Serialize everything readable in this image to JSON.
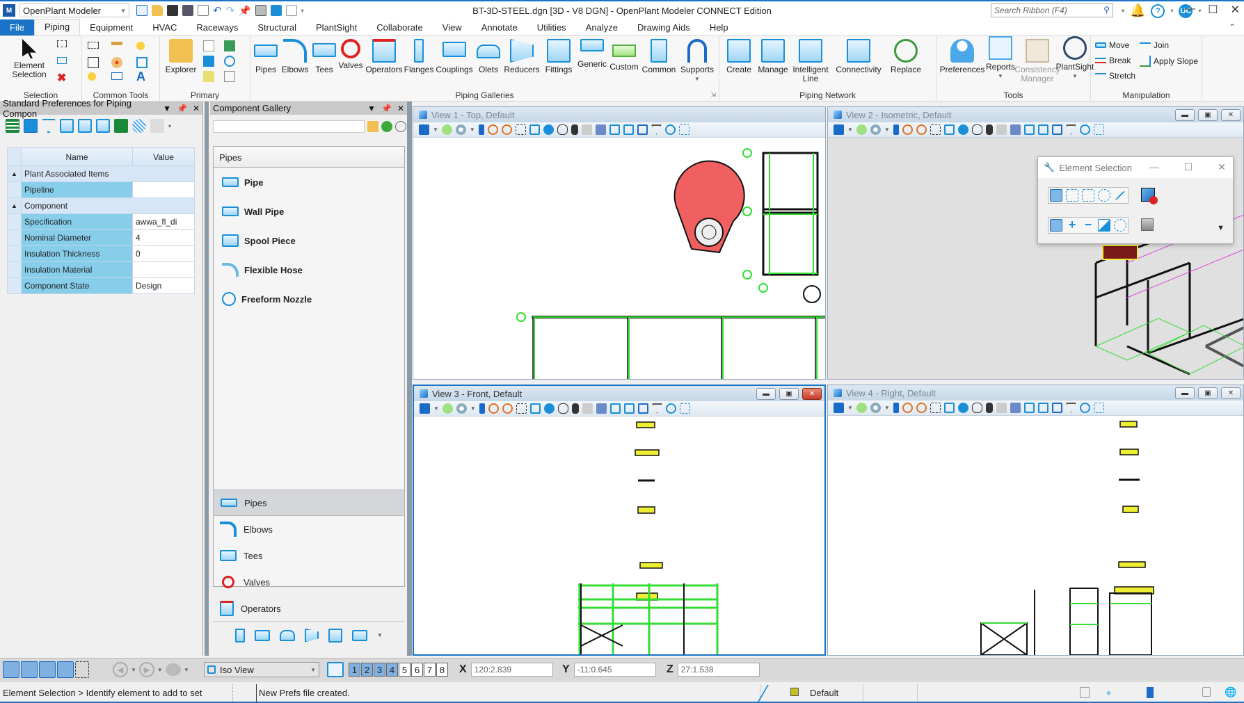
{
  "titlebar": {
    "workspace": "OpenPlant Modeler",
    "window_title": "BT-3D-STEEL.dgn [3D - V8 DGN] - OpenPlant Modeler CONNECT Edition",
    "search_placeholder": "Search Ribbon (F4)",
    "user_initials": "UC",
    "help": "?"
  },
  "tabs": [
    {
      "label": "File"
    },
    {
      "label": "Piping"
    },
    {
      "label": "Equipment"
    },
    {
      "label": "HVAC"
    },
    {
      "label": "Raceways"
    },
    {
      "label": "Structural"
    },
    {
      "label": "PlantSight"
    },
    {
      "label": "Collaborate"
    },
    {
      "label": "View"
    },
    {
      "label": "Annotate"
    },
    {
      "label": "Utilities"
    },
    {
      "label": "Analyze"
    },
    {
      "label": "Drawing Aids"
    },
    {
      "label": "Help"
    }
  ],
  "ribbon": {
    "groups": {
      "selection": "Selection",
      "common_tools": "Common Tools",
      "primary": "Primary",
      "piping_galleries": "Piping Galleries",
      "piping_network": "Piping Network",
      "tools": "Tools",
      "manipulation": "Manipulation"
    },
    "element_selection_line1": "Element",
    "element_selection_line2": "Selection",
    "explorer": "Explorer",
    "galleries": [
      "Pipes",
      "Elbows",
      "Tees",
      "Valves",
      "Operators",
      "Flanges",
      "Couplings",
      "Olets",
      "Reducers",
      "Fittings",
      "Generic",
      "Custom",
      "Common",
      "Supports"
    ],
    "network": [
      "Create",
      "Manage",
      "Intelligent Line",
      "Connectivity",
      "Replace"
    ],
    "tools": [
      "Preferences",
      "Reports",
      "Consistency Manager",
      "PlantSight"
    ],
    "manipulation": [
      "Move",
      "Join",
      "Break",
      "Apply Slope",
      "Stretch"
    ]
  },
  "left_panel": {
    "title": "Standard Preferences for Piping Compon",
    "columns": {
      "name": "Name",
      "value": "Value"
    },
    "categories": [
      {
        "label": "Plant Associated Items",
        "rows": [
          {
            "name": "Pipeline",
            "value": ""
          }
        ]
      },
      {
        "label": "Component",
        "rows": [
          {
            "name": "Specification",
            "value": "awwa_fl_di"
          },
          {
            "name": "Nominal Diameter",
            "value": "4"
          },
          {
            "name": "Insulation Thickness",
            "value": "0"
          },
          {
            "name": "Insulation Material",
            "value": ""
          },
          {
            "name": "Component State",
            "value": "Design"
          }
        ]
      }
    ]
  },
  "gallery": {
    "title": "Component Gallery",
    "search_value": "",
    "section": "Pipes",
    "items": [
      "Pipe",
      "Wall Pipe",
      "Spool Piece",
      "Flexible Hose",
      "Freeform Nozzle"
    ],
    "nav": [
      "Pipes",
      "Elbows",
      "Tees",
      "Valves",
      "Operators"
    ],
    "selected_nav": "Pipes"
  },
  "views": [
    {
      "title": "View 1 - Top, Default"
    },
    {
      "title": "View 2 - Isometric, Default"
    },
    {
      "title": "View 3 - Front, Default"
    },
    {
      "title": "View 4 - Right, Default"
    }
  ],
  "element_selection": {
    "title": "Element Selection"
  },
  "bottom_toolbar": {
    "view_mode": "Iso View",
    "view_numbers": [
      "1",
      "2",
      "3",
      "4",
      "5",
      "6",
      "7",
      "8"
    ],
    "active_views": [
      "1",
      "2",
      "3",
      "4"
    ],
    "x_label": "X",
    "x_value": "120:2.839",
    "y_label": "Y",
    "y_value": "-11:0.645",
    "z_label": "Z",
    "z_value": "27:1.538"
  },
  "status": {
    "prompt": "Element Selection > Identify element to add to set",
    "message": "New Prefs file created.",
    "level": "Default"
  },
  "colors": {
    "accent": "#1a73c6",
    "property_name_bg": "#87ceeb",
    "structure_green": "#33dd33",
    "equipment_red": "#f06060"
  }
}
